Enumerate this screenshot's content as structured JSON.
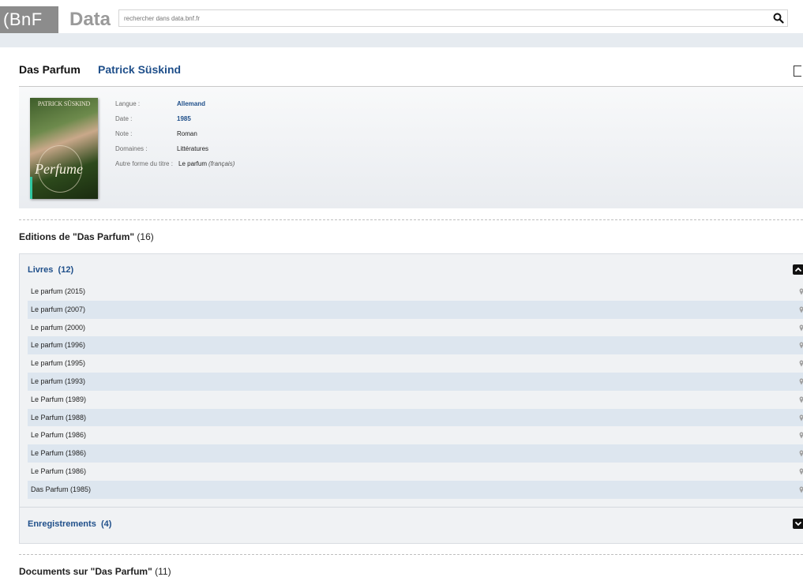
{
  "header": {
    "logo_text": "(BnF",
    "app_name": "Data",
    "search_placeholder": "rechercher dans data.bnf.fr"
  },
  "work": {
    "title": "Das Parfum",
    "author": "Patrick Süskind"
  },
  "cover": {
    "author_text": "PATRICK SÜSKIND",
    "title_text": "Perfume"
  },
  "notice": {
    "fields": [
      {
        "label": "Langue :",
        "value": "Allemand"
      },
      {
        "label": "Date :",
        "value": "1985"
      },
      {
        "label": "Note :",
        "value": "Roman"
      },
      {
        "label": "Domaines :",
        "value": "Littératures"
      }
    ],
    "alt_title_label": "Autre forme du titre :",
    "alt_title_value": "Le parfum",
    "alt_title_lang": "(français)"
  },
  "editions": {
    "heading_title": "Editions de \"Das Parfum\"",
    "heading_count": "(16)",
    "books": {
      "label": "Livres",
      "count": "(12)",
      "items": [
        "Le parfum (2015)",
        "Le parfum (2007)",
        "Le parfum (2000)",
        "Le parfum (1996)",
        "Le parfum (1995)",
        "Le parfum (1993)",
        "Le Parfum (1989)",
        "Le Parfum (1988)",
        "Le Parfum (1986)",
        "Le Parfum (1986)",
        "Le Parfum (1986)",
        "Das Parfum (1985)"
      ]
    },
    "recordings": {
      "label": "Enregistrements",
      "count": "(4)"
    }
  },
  "documents": {
    "heading_title": "Documents sur \"Das Parfum\"",
    "heading_count": "(11)"
  },
  "colors": {
    "link_blue": "#1f4f8a",
    "row_alt": "#dde6ef",
    "logo_gray": "#8c8c8c"
  }
}
